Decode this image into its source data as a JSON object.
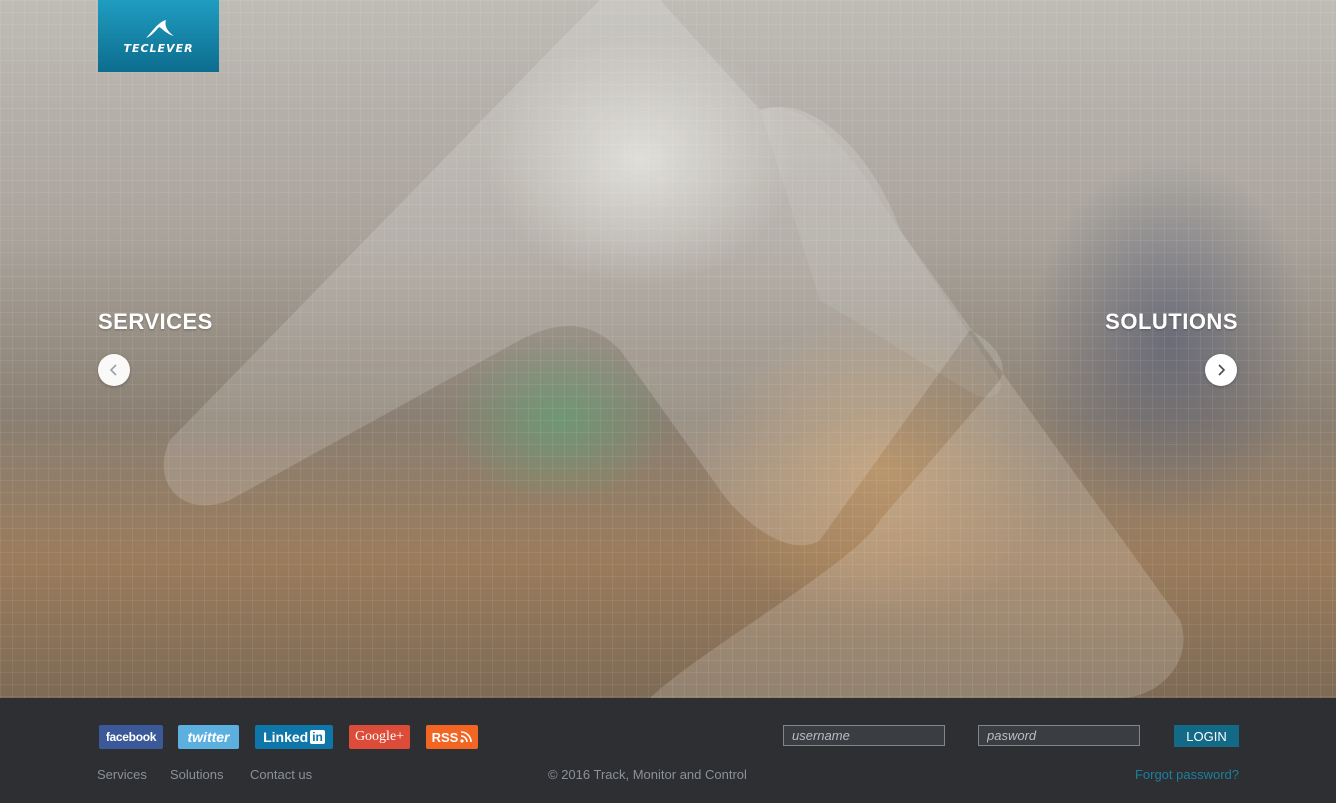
{
  "logo": {
    "text": "TECLEVER"
  },
  "hero": {
    "left_label": "SERVICES",
    "right_label": "SOLUTIONS",
    "prev_icon": "chevron-left-icon",
    "next_icon": "chevron-right-icon"
  },
  "social": {
    "facebook": "facebook",
    "twitter": "twitter",
    "linkedin_text": "Linked",
    "linkedin_box": "in",
    "google": "Google+",
    "rss": "RSS"
  },
  "login": {
    "username_placeholder": "username",
    "password_placeholder": "pasword",
    "button": "LOGIN",
    "forgot": "Forgot password?"
  },
  "footer": {
    "links": [
      "Services",
      "Solutions",
      "Contact us"
    ],
    "copyright": "© 2016 Track, Monitor and Control"
  },
  "colors": {
    "logo_bg": "#1a8fb3",
    "login_button": "#136a86",
    "forgot_link": "#1d7fa0",
    "footer_bg": "#2d2f32"
  }
}
